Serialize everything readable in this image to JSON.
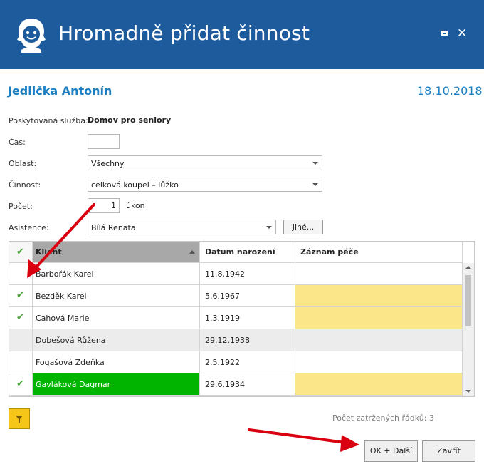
{
  "window": {
    "title": "Hromadně přidat činnost",
    "icons": {
      "logo": "caregiver-logo-icon",
      "maximize": "maximize-icon",
      "close": "close-icon"
    }
  },
  "client": {
    "name": "Jedlička Antonín",
    "date": "18.10.2018"
  },
  "form": {
    "service_label": "Poskytovaná služba:",
    "service_value": "Domov pro seniory",
    "time_label": "Čas:",
    "time_value": "",
    "area_label": "Oblast:",
    "area_value": "Všechny",
    "activity_label": "Činnost:",
    "activity_value": "celková koupel – lůžko",
    "count_label": "Počet:",
    "count_value": "1",
    "count_unit": "úkon",
    "assist_label": "Asistence:",
    "assist_value": "Bílá Renata",
    "other_button": "Jiné..."
  },
  "grid": {
    "columns": [
      "Klient",
      "Datum narození",
      "Záznam péče"
    ],
    "check_glyph": "✔",
    "rows": [
      {
        "checked": false,
        "client": "Barbořák Karel",
        "dob": "11.8.1942",
        "record": "",
        "highlight": "none"
      },
      {
        "checked": true,
        "client": "Bezděk Karel",
        "dob": "5.6.1967",
        "record": "",
        "highlight": "yellow"
      },
      {
        "checked": true,
        "client": "Cahová Marie",
        "dob": "1.3.1919",
        "record": "",
        "highlight": "yellow"
      },
      {
        "checked": false,
        "client": "Dobešová Růžena",
        "dob": "29.12.1938",
        "record": "",
        "highlight": "gray"
      },
      {
        "checked": false,
        "client": "Fogašová Zdeňka",
        "dob": "2.5.1922",
        "record": "",
        "highlight": "none"
      },
      {
        "checked": true,
        "client": "Gavláková Dagmar",
        "dob": "29.6.1934",
        "record": "",
        "highlight": "selected"
      }
    ]
  },
  "footer": {
    "filter_icon": "filter-icon",
    "count_text": "Počet zatržených řádků: 3",
    "ok_button": "OK + Další",
    "close_button": "Zavřít"
  },
  "colors": {
    "header_bg": "#1e5b9c",
    "accent_text": "#1b7fc2",
    "check_green": "#4aa53a",
    "row_yellow": "#fce68a",
    "row_selected": "#00b400",
    "row_gray": "#ececec",
    "annotation_red": "#d9000f",
    "filter_yellow": "#f5c518"
  }
}
